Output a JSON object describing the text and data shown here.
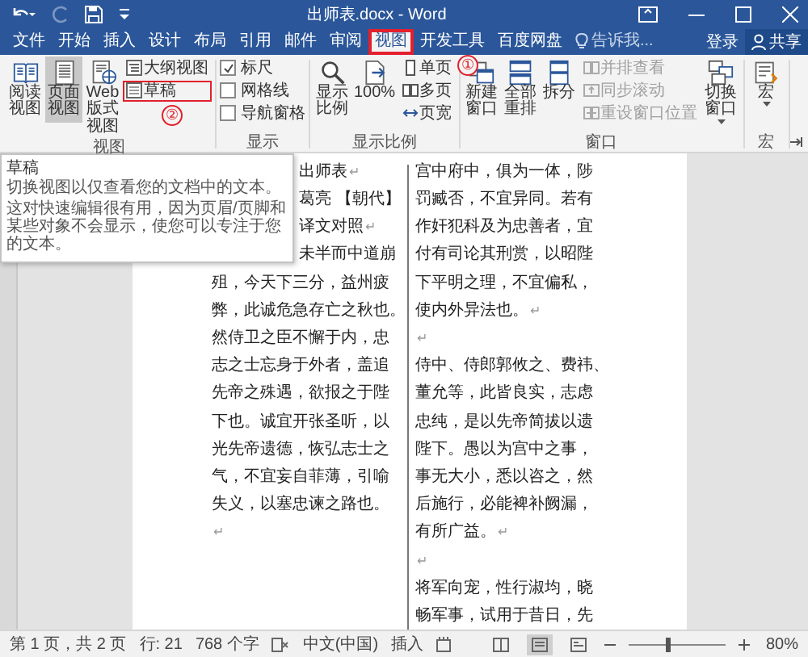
{
  "title_bar": {
    "title": "出师表.docx - Word"
  },
  "tabs": [
    {
      "label": "文件",
      "selected": false,
      "highlighted": false
    },
    {
      "label": "开始",
      "selected": false,
      "highlighted": false
    },
    {
      "label": "插入",
      "selected": false,
      "highlighted": false
    },
    {
      "label": "设计",
      "selected": false,
      "highlighted": false
    },
    {
      "label": "布局",
      "selected": false,
      "highlighted": false
    },
    {
      "label": "引用",
      "selected": false,
      "highlighted": false
    },
    {
      "label": "邮件",
      "selected": false,
      "highlighted": false
    },
    {
      "label": "审阅",
      "selected": false,
      "highlighted": false
    },
    {
      "label": "视图",
      "selected": true,
      "highlighted": true
    },
    {
      "label": "开发工具",
      "selected": false,
      "highlighted": false
    },
    {
      "label": "百度网盘",
      "selected": false,
      "highlighted": false
    }
  ],
  "tell_me": {
    "placeholder": "告诉我..."
  },
  "sign_in": "登录",
  "share": "共享",
  "ribbon": {
    "groups": [
      {
        "label": "视图",
        "items": [
          {
            "kind": "large",
            "label": "阅读视图",
            "selected": false,
            "highlighted": false
          },
          {
            "kind": "large",
            "label": "页面视图",
            "selected": true,
            "highlighted": false
          },
          {
            "kind": "large",
            "label": "Web 版式视图",
            "selected": false,
            "highlighted": false
          },
          {
            "kind": "small",
            "label": "大纲视图",
            "selected": false,
            "highlighted": false
          },
          {
            "kind": "small",
            "label": "草稿",
            "selected": false,
            "highlighted": true
          }
        ]
      },
      {
        "label": "显示",
        "items": [
          {
            "kind": "check",
            "label": "标尺",
            "checked": true
          },
          {
            "kind": "check",
            "label": "网格线",
            "checked": false
          },
          {
            "kind": "check",
            "label": "导航窗格",
            "checked": false
          }
        ]
      },
      {
        "label": "显示比例",
        "items": [
          {
            "kind": "large",
            "label": "显示比例"
          },
          {
            "kind": "large",
            "label": "100%"
          },
          {
            "kind": "small",
            "label": "单页"
          },
          {
            "kind": "small",
            "label": "多页"
          },
          {
            "kind": "small",
            "label": "页宽"
          }
        ]
      },
      {
        "label": "窗口",
        "items": [
          {
            "kind": "large",
            "label": "新建窗口",
            "disabled": false
          },
          {
            "kind": "large",
            "label": "全部重排",
            "disabled": false
          },
          {
            "kind": "large",
            "label": "拆分",
            "disabled": false
          },
          {
            "kind": "small",
            "label": "并排查看",
            "disabled": true
          },
          {
            "kind": "small",
            "label": "同步滚动",
            "disabled": true
          },
          {
            "kind": "small",
            "label": "重设窗口位置",
            "disabled": true
          },
          {
            "kind": "large",
            "label": "切换窗口",
            "disabled": false,
            "dropdown": true
          }
        ]
      },
      {
        "label": "宏",
        "items": [
          {
            "kind": "large",
            "label": "宏",
            "dropdown": true
          }
        ]
      }
    ]
  },
  "annotations": [
    {
      "text": "①"
    },
    {
      "text": "②"
    }
  ],
  "document": {
    "tooltip": {
      "title": "草稿",
      "paragraphs": [
        "切换视图以仅查看您的文档中的文本。",
        "这对快速编辑很有用，因为页眉/页脚和某些对象不会显示，使您可以专注于您的文本。"
      ]
    },
    "left_column": [
      {
        "text": "出师表",
        "end": "↵"
      },
      {
        "text": "葛亮 【朝代】"
      },
      {
        "text": "译文对照",
        "end": "↵"
      },
      {
        "text": "未半而中道崩"
      },
      {
        "text": "殂，今天下三分，益州疲"
      },
      {
        "text": "弊，此诚危急存亡之秋也。"
      },
      {
        "text": "然侍卫之臣不懈于内，忠"
      },
      {
        "text": "志之士忘身于外者，盖追"
      },
      {
        "text": "先帝之殊遇，欲报之于陛"
      },
      {
        "text": "下也。诚宜开张圣听，以"
      },
      {
        "text": "光先帝遗德，恢弘志士之"
      },
      {
        "text": "气，不宜妄自菲薄，引喻"
      },
      {
        "text": "失义，以塞忠谏之路也。"
      },
      {
        "end": "↵"
      }
    ],
    "right_column": [
      {
        "text": "宫中府中，俱为一体，陟"
      },
      {
        "text": "罚臧否，不宜异同。若有"
      },
      {
        "text": "作奸犯科及为忠善者，宜"
      },
      {
        "text": "付有司论其刑赏，以昭陛"
      },
      {
        "text": "下平明之理，不宜偏私，"
      },
      {
        "text": "使内外异法也。",
        "end": "↵"
      },
      {
        "end": "↵"
      },
      {
        "text": "侍中、侍郎郭攸之、费祎、"
      },
      {
        "text": "董允等，此皆良实，志虑"
      },
      {
        "text": "忠纯，是以先帝简拔以遗"
      },
      {
        "text": "陛下。愚以为宫中之事，"
      },
      {
        "text": "事无大小，悉以咨之，然"
      },
      {
        "text": "后施行，必能裨补阙漏，"
      },
      {
        "text": "有所广益。",
        "end": "↵"
      },
      {
        "end": "↵"
      },
      {
        "text": "将军向宠，性行淑均，晓"
      },
      {
        "text": "畅军事，试用于昔日，先"
      }
    ]
  },
  "status_bar": {
    "page": "第 1 页，共 2 页",
    "line": "行: 21",
    "words": "768 个字",
    "language": "中文(中国)",
    "mode": "插入",
    "view_buttons": [
      {
        "selected": false
      },
      {
        "selected": true
      },
      {
        "selected": false
      }
    ],
    "zoom": {
      "level": 0.4,
      "reading": "80%"
    }
  }
}
